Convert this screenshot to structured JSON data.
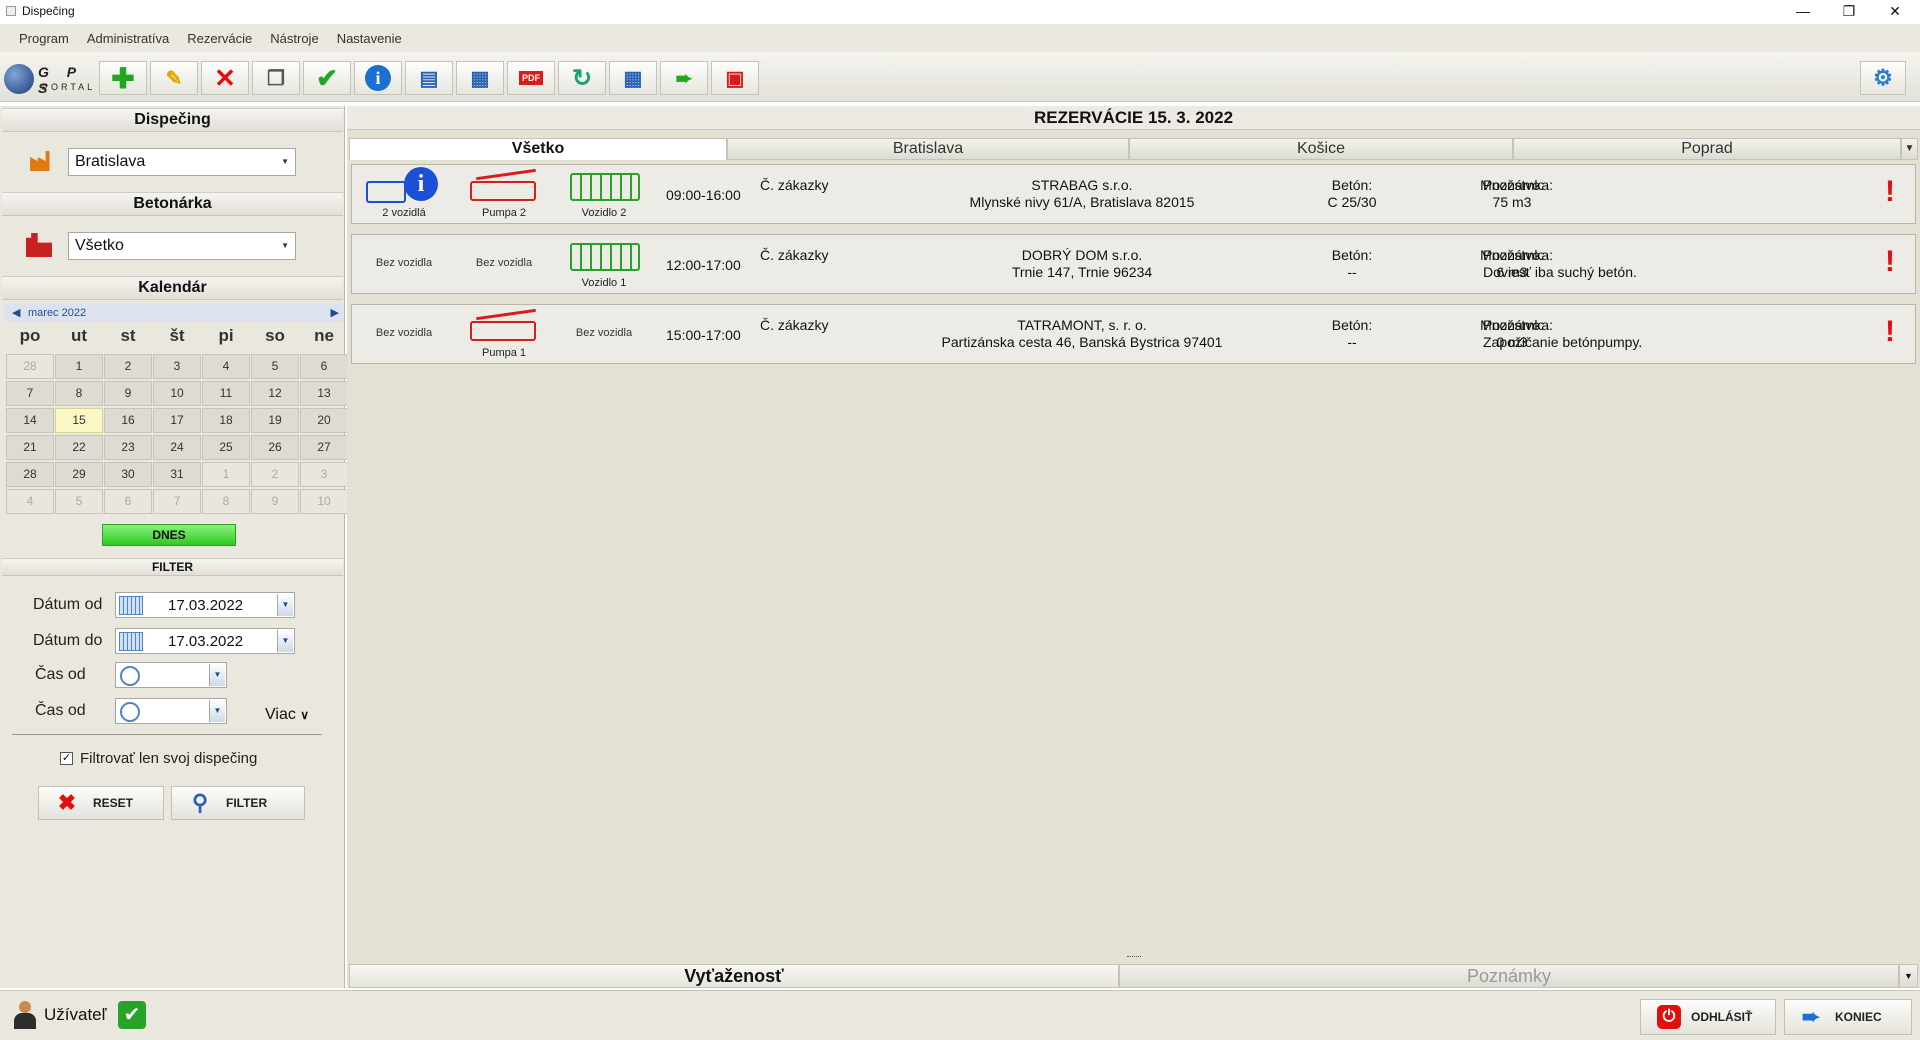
{
  "window": {
    "title": "Dispečing"
  },
  "menu": [
    "Program",
    "Administratíva",
    "Rezervácie",
    "Nástroje",
    "Nastavenie"
  ],
  "logo": {
    "line1": "G P S",
    "line2": "PORTAL"
  },
  "toolbar_icons": [
    "add-icon",
    "edit-icon",
    "delete-icon",
    "copy-icon",
    "confirm-icon",
    "info-icon",
    "export-icon",
    "import-icon",
    "pdf-icon",
    "refresh-icon",
    "calendar-icon",
    "exit-door-icon",
    "calendar-event-icon"
  ],
  "toolbar_pdf_text": "PDF",
  "left": {
    "dispecing_title": "Dispečing",
    "dispecing_value": "Bratislava",
    "betonarka_title": "Betonárka",
    "betonarka_value": "Všetko",
    "kalendar_title": "Kalendár",
    "month": "marec 2022",
    "dow": [
      "po",
      "ut",
      "st",
      "št",
      "pi",
      "so",
      "ne"
    ],
    "weeks": [
      [
        "28",
        "1",
        "2",
        "3",
        "4",
        "5",
        "6"
      ],
      [
        "7",
        "8",
        "9",
        "10",
        "11",
        "12",
        "13"
      ],
      [
        "14",
        "15",
        "16",
        "17",
        "18",
        "19",
        "20"
      ],
      [
        "21",
        "22",
        "23",
        "24",
        "25",
        "26",
        "27"
      ],
      [
        "28",
        "29",
        "30",
        "31",
        "1",
        "2",
        "3"
      ],
      [
        "4",
        "5",
        "6",
        "7",
        "8",
        "9",
        "10"
      ]
    ],
    "today_button": "DNES",
    "filter_title": "FILTER",
    "datum_od_label": "Dátum od",
    "datum_od": "17.03.2022",
    "datum_do_label": "Dátum do",
    "datum_do": "17.03.2022",
    "cas_od_label_1": "Čas od",
    "cas_od_label_2": "Čas od",
    "more_label": "Viac",
    "checkbox_label": "Filtrovať len svoj dispečing",
    "reset_label": "RESET",
    "filter_label": "FILTER"
  },
  "main": {
    "title": "REZERVÁCIE 15. 3. 2022",
    "tabs": [
      "Všetko",
      "Bratislava",
      "Košice",
      "Poprad"
    ],
    "reservations": [
      {
        "slot1": "2 vozidlá",
        "slot2": "Pumpa 2",
        "slot3": "Vozidlo 2",
        "time": "09:00-16:00",
        "order_label": "Č. zákazky",
        "customer": "STRABAG s.r.o.",
        "address": "Mlynské nivy 61/A, Bratislava 82015",
        "beton_label": "Betón:",
        "beton": "C 25/30",
        "mnoz_label": "Množstvo:",
        "mnoz": "75 m3",
        "pozn_label": "Poznámka:",
        "pozn": ""
      },
      {
        "slot1": "Bez vozidla",
        "slot2": "Bez vozidla",
        "slot3": "Vozidlo 1",
        "time": "12:00-17:00",
        "order_label": "Č. zákazky",
        "customer": "DOBRÝ DOM s.r.o.",
        "address": "Trnie 147, Trnie 96234",
        "beton_label": "Betón:",
        "beton": "--",
        "mnoz_label": "Množstvo:",
        "mnoz": "6 m3",
        "pozn_label": "Poznámka:",
        "pozn": "Doviesť iba suchý betón."
      },
      {
        "slot1": "Bez vozidla",
        "slot2": "Pumpa 1",
        "slot3": "Bez vozidla",
        "time": "15:00-17:00",
        "order_label": "Č. zákazky",
        "customer": "TATRAMONT, s. r. o.",
        "address": "Partizánska cesta 46, Banská Bystrica 97401",
        "beton_label": "Betón:",
        "beton": "--",
        "mnoz_label": "Množstvo:",
        "mnoz": "0 m3",
        "pozn_label": "Poznámka:",
        "pozn": "Zapožičanie betónpumpy."
      }
    ],
    "bottom_tabs": [
      "Vyťaženosť",
      "Poznámky"
    ]
  },
  "status": {
    "user_label": "Užívateľ",
    "logout": "ODHLÁSIŤ",
    "exit": "KONIEC"
  },
  "colors": {
    "accent_green": "#2ecb21",
    "alert_red": "#e01010",
    "vehicle_blue": "#1a4fd6",
    "pump_red": "#d81b1b",
    "truck_green": "#27a327"
  }
}
